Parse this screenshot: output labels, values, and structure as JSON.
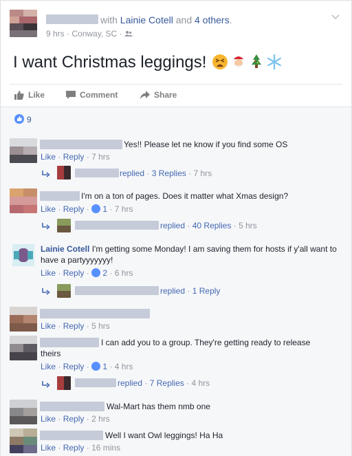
{
  "post": {
    "with_prefix": "with",
    "tagged_name": "Lainie Cotell",
    "and_text": "and",
    "others_text": "4 others",
    "period": ".",
    "time": "9 hrs",
    "location": "Conway, SC",
    "text": "I want Christmas leggings!",
    "emoji_icons": [
      "tired-face-emoji",
      "santa-emoji",
      "christmas-tree-emoji",
      "snowflake-emoji"
    ]
  },
  "actions": {
    "like": "Like",
    "comment": "Comment",
    "share": "Share"
  },
  "reactions": {
    "count": "9"
  },
  "comment_actions": {
    "like": "Like",
    "reply": "Reply",
    "sep": "·"
  },
  "comments": [
    {
      "text": "Yes!! Please let ne know if you find some OS",
      "time": "7 hrs",
      "replies": {
        "verb": "replied",
        "count_label": "3 Replies",
        "time": "7 hrs"
      }
    },
    {
      "text": "I'm on a ton of pages. Does it matter what Xmas design?",
      "likes": "1",
      "time": "7 hrs",
      "replies": {
        "verb": "replied",
        "count_label": "40 Replies",
        "time": "5 hrs"
      }
    },
    {
      "author": "Lainie Cotell",
      "text": "I'm getting some Monday! I am saving them for hosts if y'all want to have a partyyyyyyy!",
      "likes": "2",
      "time": "6 hrs",
      "replies": {
        "verb": "replied",
        "count_label": "1 Reply"
      }
    },
    {
      "text": "",
      "time": "5 hrs"
    },
    {
      "text": "I can add you to a group. They're getting ready to release theirs",
      "likes": "1",
      "time": "4 hrs",
      "replies": {
        "verb": "replied",
        "count_label": "7 Replies",
        "time": "4 hrs"
      }
    },
    {
      "text": "Wal-Mart has them nmb one",
      "time": "2 hrs"
    },
    {
      "text": "Well I want Owl leggings! Ha Ha",
      "time": "16 mins"
    }
  ],
  "colors": {
    "link": "#365899",
    "action_link": "#4267b2",
    "meta": "#90949c",
    "like_badge": "#5890ff"
  }
}
